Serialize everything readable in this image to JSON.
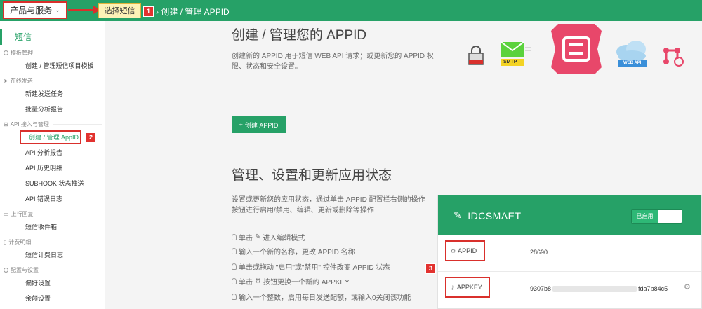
{
  "topbar": {
    "products_label": "产品与服务",
    "tooltip_label": "选择短信",
    "breadcrumb": "创建 / 管理 APPID"
  },
  "badges": [
    "1",
    "2",
    "3"
  ],
  "sidebar": {
    "title": "短信",
    "groups": [
      {
        "label": "模板管理",
        "items": [
          "创建 / 管理短信项目模板"
        ]
      },
      {
        "label": "在线发送",
        "items": [
          "新建发送任务",
          "批量分析报告"
        ]
      },
      {
        "label": "API 接入与管理",
        "items": [
          "创建 / 管理 AppID",
          "API 分析报告",
          "API 历史明细",
          "SUBHOOK 状态推送",
          "API 错误日志"
        ]
      },
      {
        "label": "上行回复",
        "items": [
          "短信收件箱"
        ]
      },
      {
        "label": "计费明细",
        "items": [
          "短信计费日志"
        ]
      },
      {
        "label": "配置与设置",
        "items": [
          "偏好设置",
          "余额设置"
        ]
      }
    ]
  },
  "main": {
    "title": "创建 / 管理您的 APPID",
    "description": "创建新的 APPID 用于短信 WEB API 请求；或更新您的 APPID 权限、状态和安全设置。",
    "create_button": "创建 APPID",
    "section_title": "管理、设置和更新应用状态",
    "section_desc": "设置或更新您的应用状态，通过单击 APPID 配置栏右侧的操作按钮进行启用/禁用、编辑、更新或删除等操作",
    "tips": [
      {
        "before": "单击",
        "after": "进入编辑模式"
      },
      {
        "before": "输入一个新的名称，更改 APPID 名称",
        "after": ""
      },
      {
        "before": "单击或拖动 \"启用\"或\"禁用\" 控件改变 APPID 状态",
        "after": ""
      },
      {
        "before": "单击",
        "after": "按钮更换一个新的 APPKEY"
      },
      {
        "before": "输入一个整数，启用每日发送配额，或输入0关闭该功能",
        "after": ""
      }
    ],
    "hero_labels": {
      "smtp": "SMTP",
      "webapi": "WEB API"
    }
  },
  "app_card": {
    "name": "IDCSMAET",
    "toggle_label": "已启用",
    "appid_label": "APPID",
    "appid_value": "28690",
    "appkey_label": "APPKEY",
    "appkey_prefix": "9307b8",
    "appkey_suffix": "fda7b84c5"
  },
  "colors": {
    "brand_green": "#26a167",
    "highlight_red": "#d9302c",
    "hero_pink": "#e8476a"
  },
  "icons": [
    "chevron-down-icon",
    "lock-icon",
    "smtp-envelope-icon",
    "app-logo-icon",
    "cloud-webapi-icon",
    "gear-network-icon",
    "plus-icon",
    "pencil-icon",
    "bulb-icon",
    "gear-icon",
    "key-icon"
  ]
}
